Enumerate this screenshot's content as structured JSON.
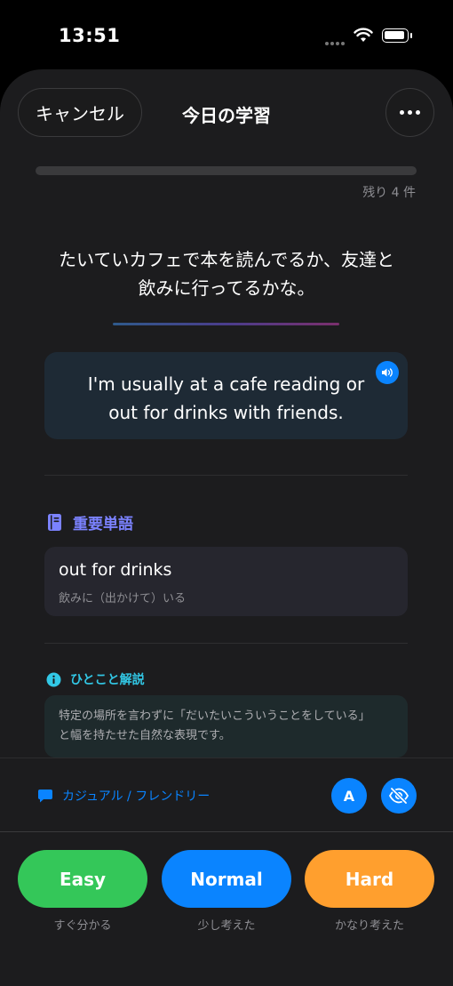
{
  "status_bar": {
    "time": "13:51"
  },
  "header": {
    "cancel_label": "キャンセル",
    "title": "今日の学習"
  },
  "progress": {
    "fraction": 0,
    "remaining_label": "残り 4 件"
  },
  "prompt": {
    "line1": "たいていカフェで本を読んでるか、友達と",
    "line2": "飲みに行ってるかな。"
  },
  "answer": {
    "line1": "I'm usually at a cafe reading or",
    "line2": "out for drinks with friends."
  },
  "vocab": {
    "heading": "重要単語",
    "term": "out for drinks",
    "meaning": "飲みに（出かけて）いる"
  },
  "note": {
    "heading": "ひとこと解説",
    "line1": "特定の場所を言わずに「だいたいこういうことをしている」",
    "line2": "と幅を持たせた自然な表現です。"
  },
  "tone": {
    "label": "カジュアル / フレンドリー",
    "a_button": "A"
  },
  "ratings": [
    {
      "label": "Easy",
      "sub": "すぐ分かる",
      "color": "#34c759"
    },
    {
      "label": "Normal",
      "sub": "少し考えた",
      "color": "#0a84ff"
    },
    {
      "label": "Hard",
      "sub": "かなり考えた",
      "color": "#ff9f2e"
    }
  ]
}
